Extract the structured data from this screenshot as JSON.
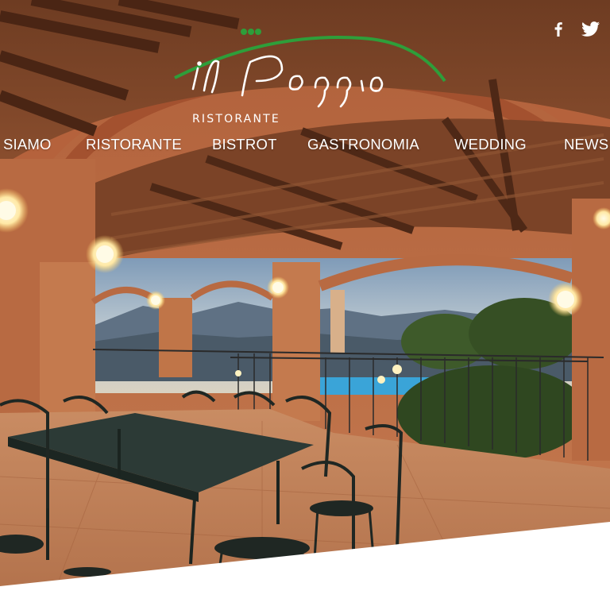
{
  "brand": {
    "script_name": "il Poggio",
    "subtitle": "RISTORANTE",
    "accent_color": "#2e9e3a"
  },
  "social": {
    "items": [
      {
        "icon": "facebook-icon",
        "label": "f"
      },
      {
        "icon": "twitter-icon",
        "label": ""
      }
    ]
  },
  "nav": {
    "items": [
      {
        "label": "SIAMO"
      },
      {
        "label": "RISTORANTE"
      },
      {
        "label": "BISTROT"
      },
      {
        "label": "GASTRONOMIA"
      },
      {
        "label": "WEDDING"
      },
      {
        "label": "NEWS"
      }
    ]
  }
}
